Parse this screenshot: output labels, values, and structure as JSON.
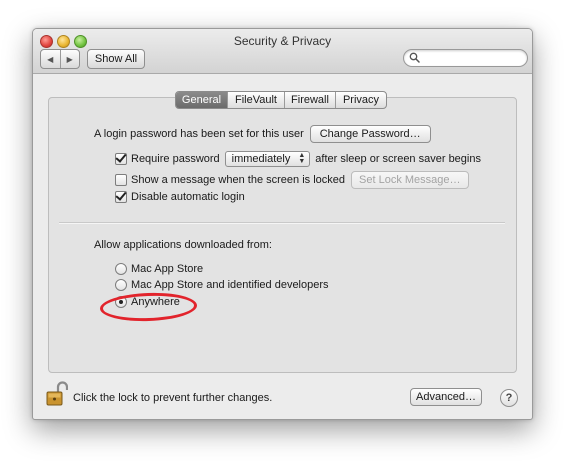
{
  "window": {
    "title": "Security & Privacy"
  },
  "toolbar": {
    "back_icon": "◀",
    "forward_icon": "▶",
    "show_all_label": "Show All",
    "search_placeholder": ""
  },
  "tabs": [
    {
      "label": "General",
      "selected": true
    },
    {
      "label": "FileVault",
      "selected": false
    },
    {
      "label": "Firewall",
      "selected": false
    },
    {
      "label": "Privacy",
      "selected": false
    }
  ],
  "general": {
    "login_password_text": "A login password has been set for this user",
    "change_password_label": "Change Password…",
    "require_password": {
      "checked": true,
      "label": "Require password",
      "select_value": "immediately",
      "suffix": "after sleep or screen saver begins"
    },
    "show_message": {
      "checked": false,
      "label": "Show a message when the screen is locked",
      "button_label": "Set Lock Message…"
    },
    "disable_auto_login": {
      "checked": true,
      "label": "Disable automatic login"
    },
    "allow_apps_label": "Allow applications downloaded from:",
    "radio_options": [
      {
        "label": "Mac App Store",
        "selected": false
      },
      {
        "label": "Mac App Store and identified developers",
        "selected": false
      },
      {
        "label": "Anywhere",
        "selected": true
      }
    ]
  },
  "footer": {
    "lock_text": "Click the lock to prevent further changes.",
    "advanced_label": "Advanced…",
    "help_label": "?"
  },
  "colors": {
    "highlight_ellipse": "#e2242c",
    "selected_tab": "#7a7a7a"
  }
}
